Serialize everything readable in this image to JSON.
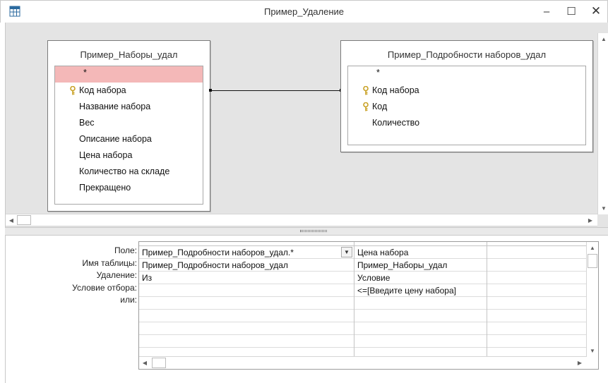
{
  "window": {
    "title": "Пример_Удаление",
    "minimize_glyph": "–",
    "maximize_glyph": "☐",
    "close_glyph": "✕"
  },
  "tables": [
    {
      "title": "Пример_Наборы_удал",
      "fields": [
        {
          "label": "*",
          "key": false,
          "selected": true
        },
        {
          "label": "Код набора",
          "key": true
        },
        {
          "label": "Название набора",
          "key": false
        },
        {
          "label": "Вес",
          "key": false
        },
        {
          "label": "Описание набора",
          "key": false
        },
        {
          "label": "Цена набора",
          "key": false
        },
        {
          "label": "Количество на складе",
          "key": false
        },
        {
          "label": "Прекращено",
          "key": false
        }
      ]
    },
    {
      "title": "Пример_Подробности наборов_удал",
      "fields": [
        {
          "label": "*",
          "key": false
        },
        {
          "label": "Код набора",
          "key": true
        },
        {
          "label": "Код",
          "key": true
        },
        {
          "label": "Количество",
          "key": false
        }
      ]
    }
  ],
  "grid": {
    "row_labels": [
      "Поле:",
      "Имя таблицы:",
      "Удаление:",
      "Условие отбора:",
      "или:"
    ],
    "columns": [
      {
        "field": "Пример_Подробности наборов_удал.*",
        "table": "Пример_Подробности наборов_удал",
        "delete": "Из",
        "criteria": "",
        "or": ""
      },
      {
        "field": "Цена набора",
        "table": "Пример_Наборы_удал",
        "delete": "Условие",
        "criteria": "<=[Введите цену набора]",
        "or": ""
      },
      {
        "field": "",
        "table": "",
        "delete": "",
        "criteria": "",
        "or": ""
      }
    ]
  },
  "colors": {
    "selected_field": "#f4b8b8",
    "design_background": "#e4e4e4",
    "key_icon": "#c9a227"
  },
  "icons": {
    "window": "datasheet-window-icon",
    "key": "primary-key-icon"
  }
}
